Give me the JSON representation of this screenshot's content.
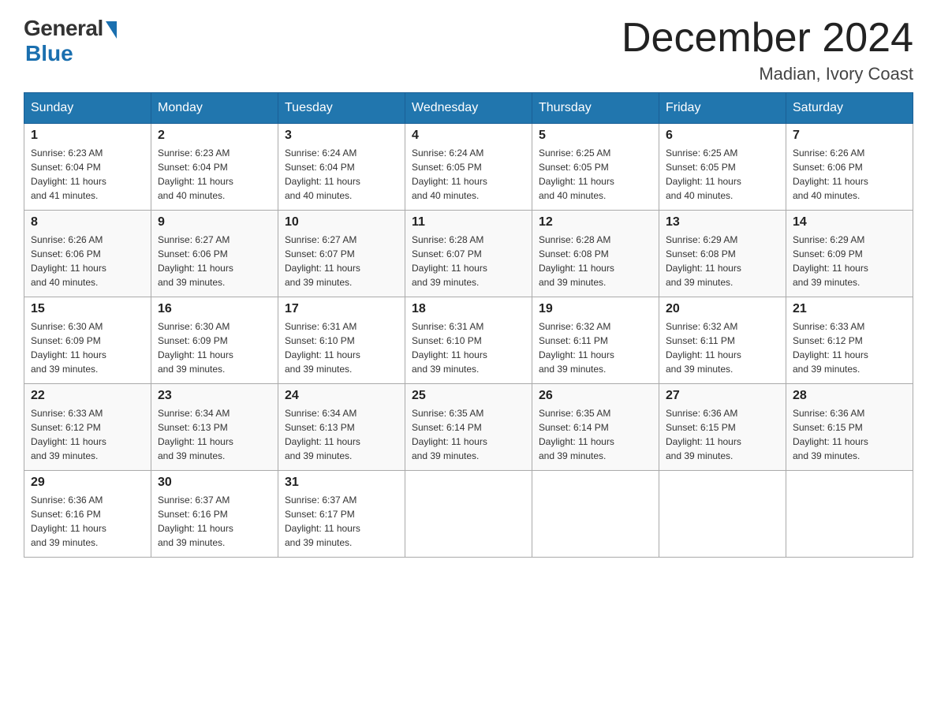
{
  "logo": {
    "general": "General",
    "blue": "Blue"
  },
  "title": "December 2024",
  "location": "Madian, Ivory Coast",
  "days_of_week": [
    "Sunday",
    "Monday",
    "Tuesday",
    "Wednesday",
    "Thursday",
    "Friday",
    "Saturday"
  ],
  "weeks": [
    [
      {
        "day": "1",
        "sunrise": "6:23 AM",
        "sunset": "6:04 PM",
        "daylight": "11 hours and 41 minutes."
      },
      {
        "day": "2",
        "sunrise": "6:23 AM",
        "sunset": "6:04 PM",
        "daylight": "11 hours and 40 minutes."
      },
      {
        "day": "3",
        "sunrise": "6:24 AM",
        "sunset": "6:04 PM",
        "daylight": "11 hours and 40 minutes."
      },
      {
        "day": "4",
        "sunrise": "6:24 AM",
        "sunset": "6:05 PM",
        "daylight": "11 hours and 40 minutes."
      },
      {
        "day": "5",
        "sunrise": "6:25 AM",
        "sunset": "6:05 PM",
        "daylight": "11 hours and 40 minutes."
      },
      {
        "day": "6",
        "sunrise": "6:25 AM",
        "sunset": "6:05 PM",
        "daylight": "11 hours and 40 minutes."
      },
      {
        "day": "7",
        "sunrise": "6:26 AM",
        "sunset": "6:06 PM",
        "daylight": "11 hours and 40 minutes."
      }
    ],
    [
      {
        "day": "8",
        "sunrise": "6:26 AM",
        "sunset": "6:06 PM",
        "daylight": "11 hours and 40 minutes."
      },
      {
        "day": "9",
        "sunrise": "6:27 AM",
        "sunset": "6:06 PM",
        "daylight": "11 hours and 39 minutes."
      },
      {
        "day": "10",
        "sunrise": "6:27 AM",
        "sunset": "6:07 PM",
        "daylight": "11 hours and 39 minutes."
      },
      {
        "day": "11",
        "sunrise": "6:28 AM",
        "sunset": "6:07 PM",
        "daylight": "11 hours and 39 minutes."
      },
      {
        "day": "12",
        "sunrise": "6:28 AM",
        "sunset": "6:08 PM",
        "daylight": "11 hours and 39 minutes."
      },
      {
        "day": "13",
        "sunrise": "6:29 AM",
        "sunset": "6:08 PM",
        "daylight": "11 hours and 39 minutes."
      },
      {
        "day": "14",
        "sunrise": "6:29 AM",
        "sunset": "6:09 PM",
        "daylight": "11 hours and 39 minutes."
      }
    ],
    [
      {
        "day": "15",
        "sunrise": "6:30 AM",
        "sunset": "6:09 PM",
        "daylight": "11 hours and 39 minutes."
      },
      {
        "day": "16",
        "sunrise": "6:30 AM",
        "sunset": "6:09 PM",
        "daylight": "11 hours and 39 minutes."
      },
      {
        "day": "17",
        "sunrise": "6:31 AM",
        "sunset": "6:10 PM",
        "daylight": "11 hours and 39 minutes."
      },
      {
        "day": "18",
        "sunrise": "6:31 AM",
        "sunset": "6:10 PM",
        "daylight": "11 hours and 39 minutes."
      },
      {
        "day": "19",
        "sunrise": "6:32 AM",
        "sunset": "6:11 PM",
        "daylight": "11 hours and 39 minutes."
      },
      {
        "day": "20",
        "sunrise": "6:32 AM",
        "sunset": "6:11 PM",
        "daylight": "11 hours and 39 minutes."
      },
      {
        "day": "21",
        "sunrise": "6:33 AM",
        "sunset": "6:12 PM",
        "daylight": "11 hours and 39 minutes."
      }
    ],
    [
      {
        "day": "22",
        "sunrise": "6:33 AM",
        "sunset": "6:12 PM",
        "daylight": "11 hours and 39 minutes."
      },
      {
        "day": "23",
        "sunrise": "6:34 AM",
        "sunset": "6:13 PM",
        "daylight": "11 hours and 39 minutes."
      },
      {
        "day": "24",
        "sunrise": "6:34 AM",
        "sunset": "6:13 PM",
        "daylight": "11 hours and 39 minutes."
      },
      {
        "day": "25",
        "sunrise": "6:35 AM",
        "sunset": "6:14 PM",
        "daylight": "11 hours and 39 minutes."
      },
      {
        "day": "26",
        "sunrise": "6:35 AM",
        "sunset": "6:14 PM",
        "daylight": "11 hours and 39 minutes."
      },
      {
        "day": "27",
        "sunrise": "6:36 AM",
        "sunset": "6:15 PM",
        "daylight": "11 hours and 39 minutes."
      },
      {
        "day": "28",
        "sunrise": "6:36 AM",
        "sunset": "6:15 PM",
        "daylight": "11 hours and 39 minutes."
      }
    ],
    [
      {
        "day": "29",
        "sunrise": "6:36 AM",
        "sunset": "6:16 PM",
        "daylight": "11 hours and 39 minutes."
      },
      {
        "day": "30",
        "sunrise": "6:37 AM",
        "sunset": "6:16 PM",
        "daylight": "11 hours and 39 minutes."
      },
      {
        "day": "31",
        "sunrise": "6:37 AM",
        "sunset": "6:17 PM",
        "daylight": "11 hours and 39 minutes."
      },
      null,
      null,
      null,
      null
    ]
  ],
  "labels": {
    "sunrise": "Sunrise: ",
    "sunset": "Sunset: ",
    "daylight": "Daylight: "
  }
}
